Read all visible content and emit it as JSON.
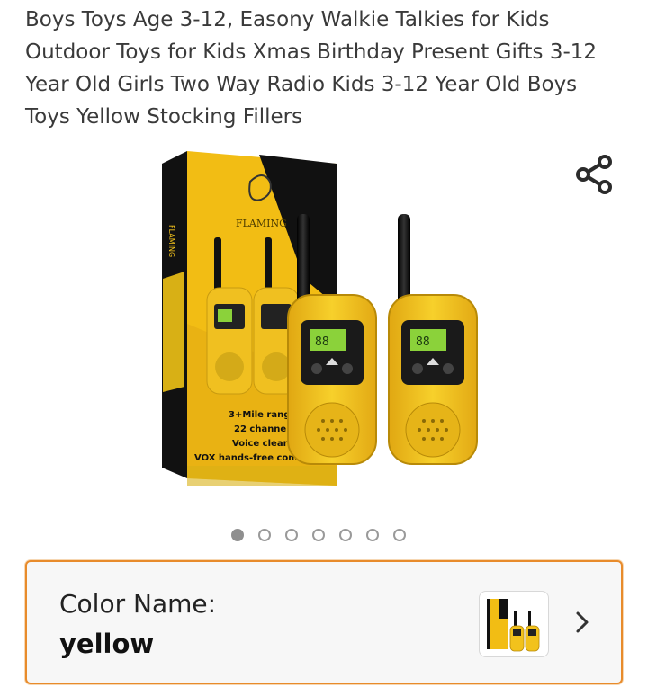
{
  "product": {
    "title": "Boys Toys Age 3-12, Easony Walkie Talkies for Kids Outdoor Toys for Kids Xmas Birthday Present Gifts 3-12 Year Old Girls Two Way Radio Kids 3-12 Year Old Boys Toys Yellow Stocking Fillers"
  },
  "image": {
    "brand": "FLAMING",
    "box_features": [
      "3+Mile range",
      "22 channels",
      "Voice clear",
      "VOX hands-free communication"
    ],
    "screen_text": "88",
    "dot_count": 7,
    "active_dot": 0
  },
  "variation": {
    "label": "Color Name:",
    "value": "yellow"
  },
  "icons": {
    "share": "share-icon",
    "chevron": "chevron-right-icon"
  },
  "colors": {
    "accent_border": "#e88b2b",
    "product_yellow": "#f2c21c",
    "box_black": "#111111"
  }
}
